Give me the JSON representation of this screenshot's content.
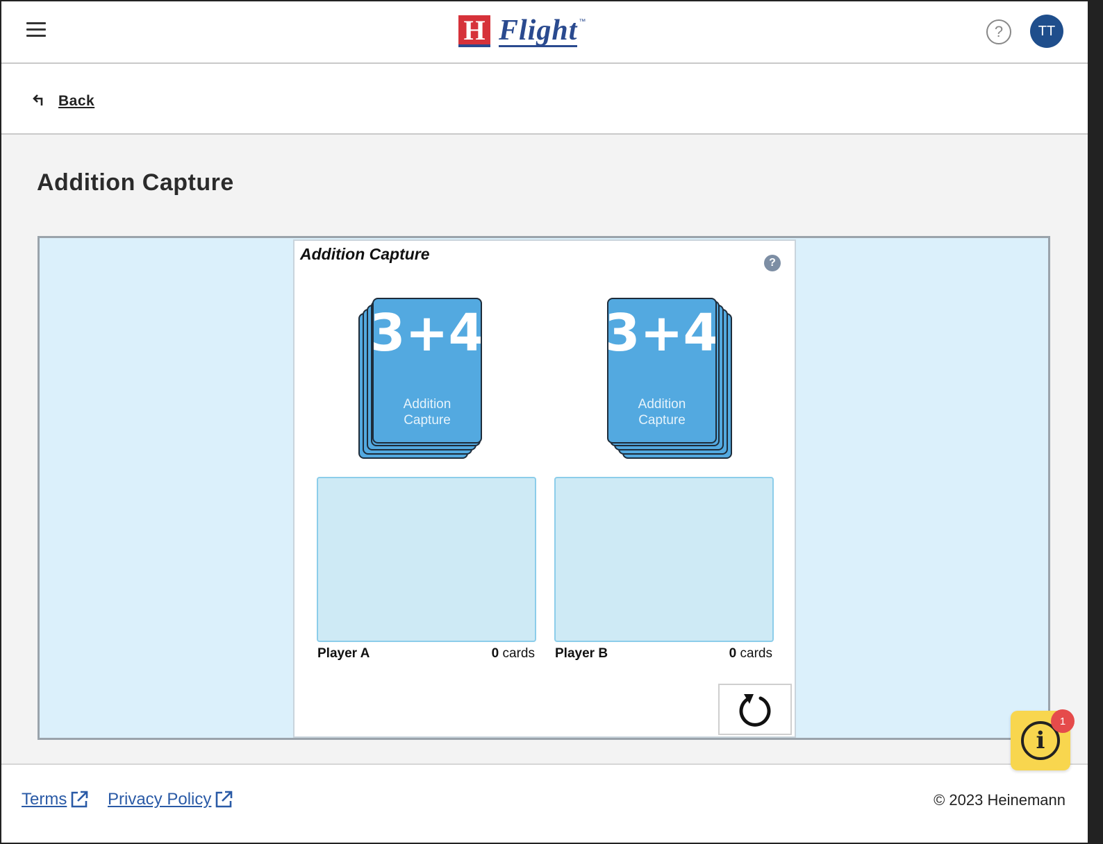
{
  "header": {
    "logo_letter": "H",
    "logo_text": "Flight",
    "logo_tm": "™",
    "help_symbol": "?",
    "avatar_initials": "TT"
  },
  "nav": {
    "back_label": "Back"
  },
  "page": {
    "title": "Addition Capture"
  },
  "game": {
    "title": "Addition Capture",
    "help_symbol": "?",
    "card_face": "3+4",
    "card_label_line1": "Addition",
    "card_label_line2": "Capture",
    "players": [
      {
        "name": "Player A",
        "count": "0",
        "unit": "cards"
      },
      {
        "name": "Player B",
        "count": "0",
        "unit": "cards"
      }
    ]
  },
  "footer": {
    "terms_label": "Terms",
    "privacy_label": "Privacy Policy",
    "copyright": "© 2023 Heinemann"
  },
  "info_widget": {
    "badge_count": "1",
    "symbol": "i"
  },
  "colors": {
    "brand_blue": "#2a4a8f",
    "brand_red": "#d6323a",
    "card_blue": "#53a9e0",
    "game_bg": "#dbf0fb",
    "capture_zone": "#ceeaf5",
    "info_yellow": "#f8d64e"
  }
}
